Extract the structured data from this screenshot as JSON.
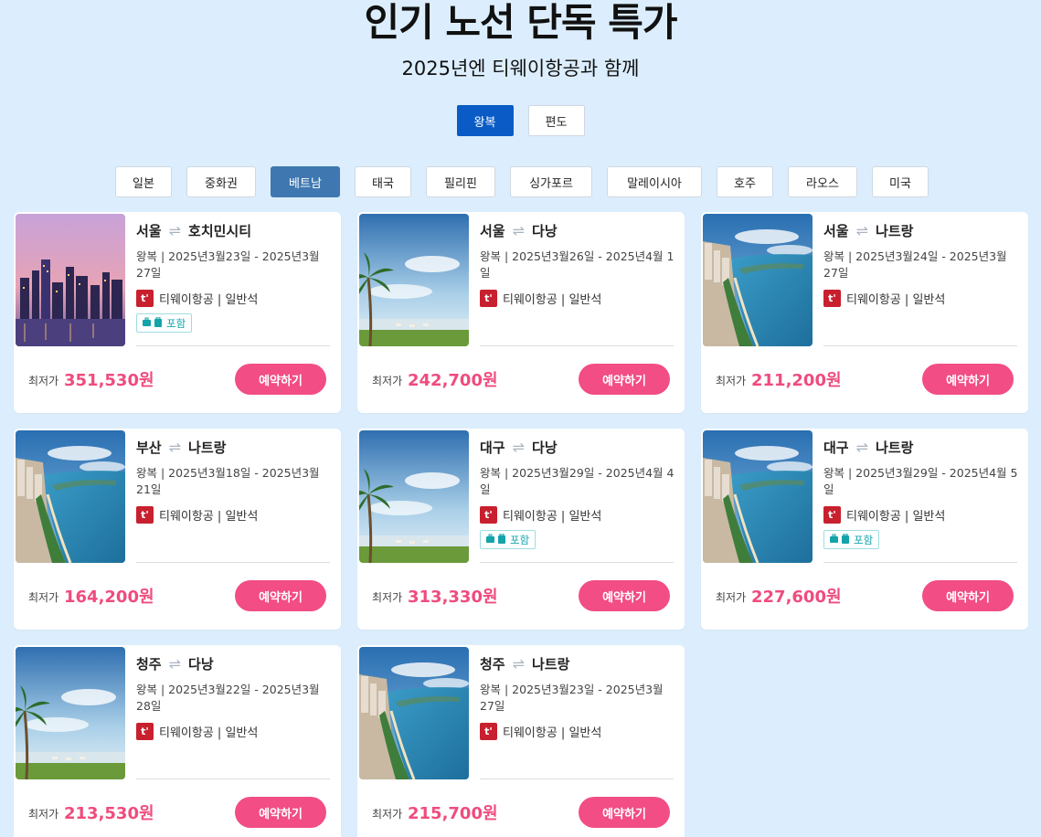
{
  "header": {
    "title": "인기 노선 단독 특가",
    "subtitle": "2025년엔 티웨이항공과 함께"
  },
  "trip_tabs": [
    {
      "label": "왕복",
      "active": true
    },
    {
      "label": "편도",
      "active": false
    }
  ],
  "region_tabs": [
    {
      "label": "일본",
      "active": false
    },
    {
      "label": "중화권",
      "active": false
    },
    {
      "label": "베트남",
      "active": true
    },
    {
      "label": "태국",
      "active": false
    },
    {
      "label": "필리핀",
      "active": false
    },
    {
      "label": "싱가포르",
      "active": false
    },
    {
      "label": "말레이시아",
      "active": false
    },
    {
      "label": "호주",
      "active": false
    },
    {
      "label": "라오스",
      "active": false
    },
    {
      "label": "미국",
      "active": false
    }
  ],
  "cards": [
    {
      "from": "서울",
      "to": "호치민시티",
      "dates": "왕복 | 2025년3월23일 - 2025년3월 27일",
      "airline": "티웨이항공 | 일반석",
      "baggage": "포함",
      "price_label": "최저가",
      "price": "351,530원",
      "book_label": "예약하기",
      "image": "city-night"
    },
    {
      "from": "서울",
      "to": "다낭",
      "dates": "왕복 | 2025년3월26일 - 2025년4월 1일",
      "airline": "티웨이항공 | 일반석",
      "baggage": null,
      "price_label": "최저가",
      "price": "242,700원",
      "book_label": "예약하기",
      "image": "palm-beach"
    },
    {
      "from": "서울",
      "to": "나트랑",
      "dates": "왕복 | 2025년3월24일 - 2025년3월 27일",
      "airline": "티웨이항공 | 일반석",
      "baggage": null,
      "price_label": "최저가",
      "price": "211,200원",
      "book_label": "예약하기",
      "image": "coast-aerial"
    },
    {
      "from": "부산",
      "to": "나트랑",
      "dates": "왕복 | 2025년3월18일 - 2025년3월 21일",
      "airline": "티웨이항공 | 일반석",
      "baggage": null,
      "price_label": "최저가",
      "price": "164,200원",
      "book_label": "예약하기",
      "image": "coast-aerial"
    },
    {
      "from": "대구",
      "to": "다낭",
      "dates": "왕복 | 2025년3월29일 - 2025년4월 4일",
      "airline": "티웨이항공 | 일반석",
      "baggage": "포함",
      "price_label": "최저가",
      "price": "313,330원",
      "book_label": "예약하기",
      "image": "palm-beach"
    },
    {
      "from": "대구",
      "to": "나트랑",
      "dates": "왕복 | 2025년3월29일 - 2025년4월 5일",
      "airline": "티웨이항공 | 일반석",
      "baggage": "포함",
      "price_label": "최저가",
      "price": "227,600원",
      "book_label": "예약하기",
      "image": "coast-aerial"
    },
    {
      "from": "청주",
      "to": "다낭",
      "dates": "왕복 | 2025년3월22일 - 2025년3월 28일",
      "airline": "티웨이항공 | 일반석",
      "baggage": null,
      "price_label": "최저가",
      "price": "213,530원",
      "book_label": "예약하기",
      "image": "palm-beach"
    },
    {
      "from": "청주",
      "to": "나트랑",
      "dates": "왕복 | 2025년3월23일 - 2025년3월 27일",
      "airline": "티웨이항공 | 일반석",
      "baggage": null,
      "price_label": "최저가",
      "price": "215,700원",
      "book_label": "예약하기",
      "image": "coast-aerial"
    }
  ],
  "icons": {
    "swap": "swap-arrows-icon",
    "airline_logo": "tway-logo-icon",
    "baggage": "baggage-icon"
  },
  "colors": {
    "background": "#dceefd",
    "accent_pink": "#f24d84",
    "active_trip_tab": "#0a5bc6",
    "active_region_tab": "#3f78b0",
    "baggage_teal": "#13a4aa"
  }
}
